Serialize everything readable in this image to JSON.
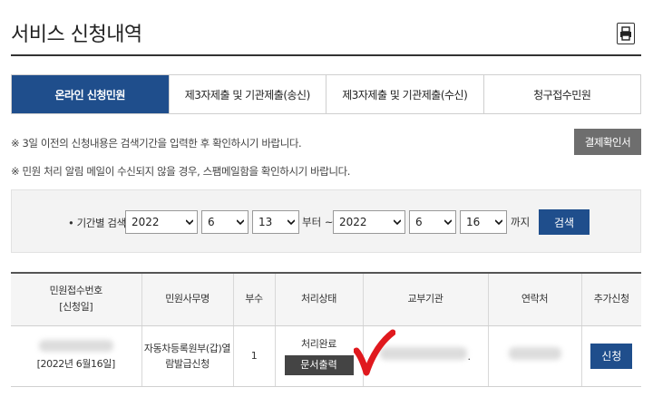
{
  "page": {
    "title": "서비스 신청내역"
  },
  "icons": {
    "print": "printer-icon",
    "check": "red-checkmark",
    "dropdown": "chevron-down-icon"
  },
  "colors": {
    "accent": "#1f4e8c",
    "receipt_button": "#6e6e6e",
    "doc_button": "#444444",
    "check": "#e0191e"
  },
  "tabs": [
    {
      "label": "온라인 신청민원",
      "active": true
    },
    {
      "label": "제3자제출 및 기관제출(송신)",
      "active": false
    },
    {
      "label": "제3자제출 및 기관제출(수신)",
      "active": false
    },
    {
      "label": "청구접수민원",
      "active": false
    }
  ],
  "notices": {
    "line1": "※ 3일 이전의 신청내용은 검색기간을 입력한 후 확인하시기 바랍니다.",
    "line2": "※ 민원 처리 알림 메일이 수신되지 않을 경우, 스팸메일함을 확인하시기 바랍니다."
  },
  "receipt_button": "결제확인서",
  "search": {
    "label": "• 기간별 검색",
    "from": {
      "year": "2022",
      "month": "6",
      "day": "13"
    },
    "from_suffix": "부터 ~",
    "to": {
      "year": "2022",
      "month": "6",
      "day": "16"
    },
    "to_suffix": "까지",
    "button": "검색"
  },
  "table": {
    "headers": [
      "민원접수번호",
      "[신청일]",
      "민원사무명",
      "부수",
      "처리상태",
      "교부기관",
      "연락처",
      "추가신청"
    ],
    "row": {
      "date": "[2022년 6월16일]",
      "service_line1": "자동차등록원부(갑)열",
      "service_line2": "람발급신청",
      "copies": "1",
      "status": "처리완료",
      "doc_button": "문서출력",
      "agency_suffix": ".",
      "apply_button": "신청"
    }
  }
}
